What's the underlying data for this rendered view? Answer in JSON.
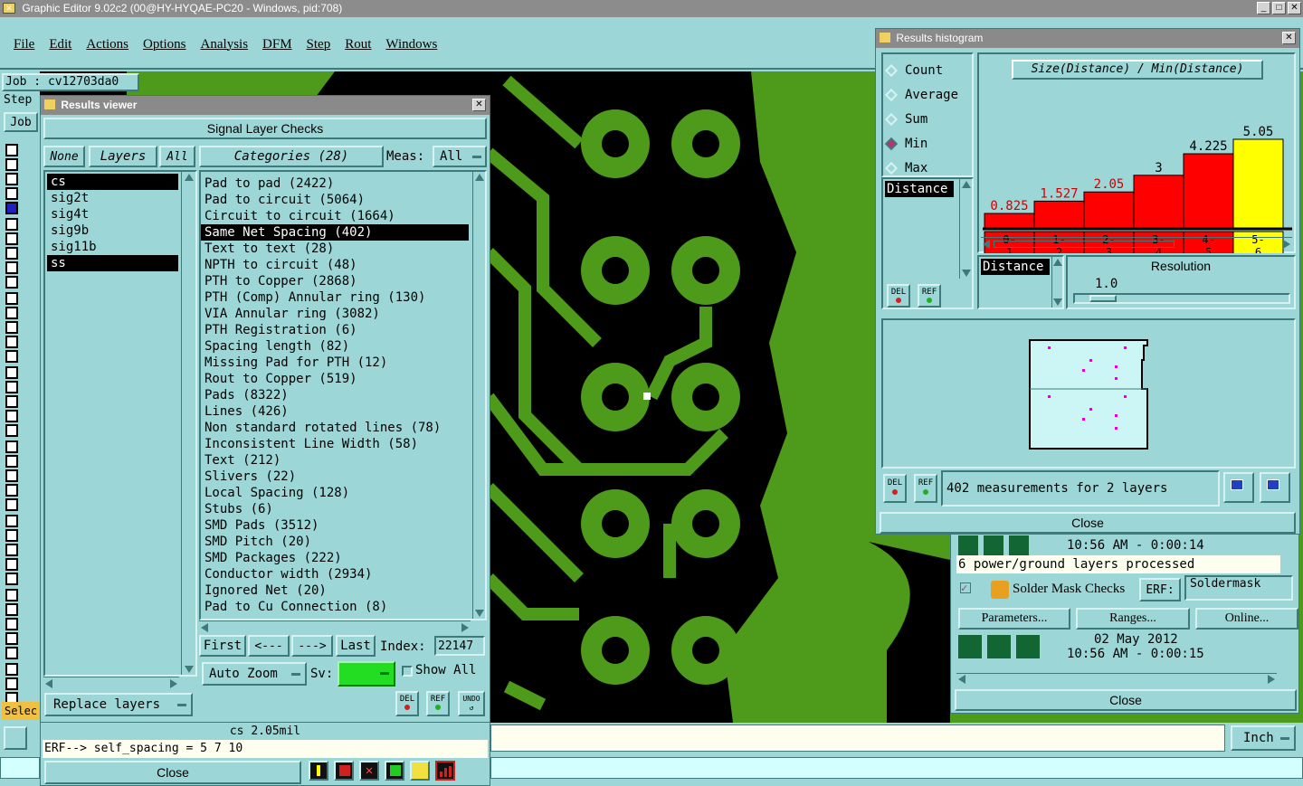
{
  "app": {
    "title": "Graphic Editor 9.02c2 (00@HY-HYQAE-PC20 - Windows, pid:708)"
  },
  "menu": [
    "File",
    "Edit",
    "Actions",
    "Options",
    "Analysis",
    "DFM",
    "Step",
    "Rout",
    "Windows"
  ],
  "left_panel": {
    "job_label": "Job : cv12703da0",
    "step_label": "Step",
    "job_btn": "Job",
    "select_label": "Selec"
  },
  "results_viewer": {
    "title": "Results viewer",
    "header": "Signal Layer Checks",
    "none_btn": "None",
    "layers_btn": "Layers",
    "all_btn": "All",
    "layers": [
      "cs",
      "sig2t",
      "sig4t",
      "sig9b",
      "sig11b",
      "ss"
    ],
    "categories_btn": "Categories (28)",
    "meas_label": "Meas:",
    "meas_value": "All",
    "categories": [
      "Pad to pad (2422)",
      "Pad to circuit (5064)",
      "Circuit to circuit (1664)",
      "Same Net Spacing (402)",
      "Text to text (28)",
      "NPTH to circuit (48)",
      "PTH to Copper (2868)",
      "PTH (Comp) Annular ring (130)",
      "VIA Annular ring (3082)",
      "PTH Registration (6)",
      "Spacing length (82)",
      "Missing Pad for PTH (12)",
      "Rout to Copper (519)",
      "Pads (8322)",
      "Lines (426)",
      "Non standard rotated lines (78)",
      "Inconsistent Line Width (58)",
      "Text (212)",
      "Slivers (22)",
      "Local Spacing (128)",
      "Stubs (6)",
      "SMD Pads (3512)",
      "SMD Pitch (20)",
      "SMD Packages (222)",
      "Conductor width (2934)",
      "Ignored Net (20)",
      "Pad to Cu Connection (8)"
    ],
    "first_btn": "First",
    "prev_btn": "<---",
    "next_btn": "--->",
    "last_btn": "Last",
    "index_label": "Index:",
    "index_value": "22147",
    "auto_zoom": "Auto Zoom",
    "sv_label": "Sv:",
    "show_all": "Show All",
    "replace_layers": "Replace layers",
    "del_btn": "DEL",
    "ref_btn": "REF",
    "undo_btn": "UNDO",
    "status": "cs 2.05mil",
    "erf_line": "ERF--> self_spacing = 5 7 10",
    "close_btn": "Close"
  },
  "histogram": {
    "title": "Results histogram",
    "radio_options": [
      "Count",
      "Average",
      "Sum",
      "Min",
      "Max"
    ],
    "selected": "Min",
    "chart_title": "Size(Distance) / Min(Distance)",
    "field_a": "Distance",
    "field_b": "Distance",
    "resolution_label": "Resolution",
    "resolution_value": "1.0",
    "del_btn": "DEL",
    "ref_btn": "REF",
    "measurements": "402 measurements for 2 layers",
    "close_btn": "Close",
    "bar_color": "#ff0000",
    "highlight_color": "#ffff00"
  },
  "chart_data": {
    "type": "bar",
    "title": "Size(Distance) / Min(Distance)",
    "categories": [
      "0-1",
      "1-2",
      "2-3",
      "3-4",
      "4-5",
      "5-6"
    ],
    "values": [
      0.825,
      1.527,
      2.05,
      3,
      4.225,
      5.05
    ],
    "value_labels": [
      "0.825",
      "1.527",
      "2.05",
      "3",
      "4.225",
      "5.05"
    ],
    "cat_top": [
      "0-",
      "1-",
      "2-",
      "3-",
      "4-",
      "5-"
    ],
    "cat_bottom": [
      "1",
      "2",
      "3",
      "4",
      "5",
      "6"
    ]
  },
  "bg_panel": {
    "time1": "10:56 AM - 0:00:14",
    "power_ground": "6 power/ground layers processed",
    "solder_mask": "Solder Mask Checks",
    "erf_label": "ERF:",
    "erf_value": "Soldermask",
    "parameters_btn": "Parameters...",
    "ranges_btn": "Ranges...",
    "online_btn": "Online...",
    "date": "02 May 2012",
    "time2": "10:56 AM - 0:00:15",
    "close_btn": "Close"
  },
  "bottom": {
    "units": "Inch"
  }
}
